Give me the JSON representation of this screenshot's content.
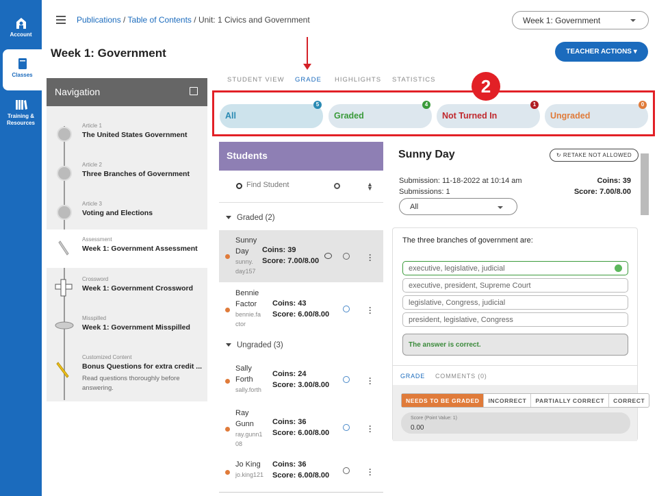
{
  "rail": {
    "items": [
      {
        "label": "Account",
        "icon": "account-icon"
      },
      {
        "label": "Classes",
        "icon": "book-icon"
      },
      {
        "label": "Training & Resources",
        "icon": "library-icon"
      }
    ]
  },
  "breadcrumb": {
    "link1": "Publications",
    "sep1": " / ",
    "link2": "Table of Contents",
    "sep2": " / ",
    "current": "Unit: 1 Civics and Government"
  },
  "week_select": {
    "value": "Week 1: Government"
  },
  "page_title": "Week 1: Government",
  "teacher_actions": "TEACHER ACTIONS ▾",
  "navigation": {
    "title": "Navigation",
    "items": [
      {
        "sub": "Article 1",
        "title": "The United States Government"
      },
      {
        "sub": "Article 2",
        "title": "Three Branches of Government"
      },
      {
        "sub": "Article 3",
        "title": "Voting and Elections"
      },
      {
        "sub": "Assessment",
        "title": "Week 1: Government Assessment"
      },
      {
        "sub": "Crossword",
        "title": "Week 1: Government Crossword"
      },
      {
        "sub": "Misspilled",
        "title": "Week 1: Government Misspilled"
      },
      {
        "sub": "Customized Content",
        "title": "Bonus Questions for extra credit ...",
        "desc": "Read questions thoroughly before answering."
      }
    ]
  },
  "tabs": [
    "STUDENT VIEW",
    "GRADE",
    "HIGHLIGHTS",
    "STATISTICS"
  ],
  "annotation_number": "2",
  "filters": [
    {
      "label": "All",
      "count": "5",
      "color": "#2a8ab3",
      "badge": "#2a8ab3"
    },
    {
      "label": "Graded",
      "count": "4",
      "color": "#3a9a3a",
      "badge": "#3a9a3a"
    },
    {
      "label": "Not Turned In",
      "count": "1",
      "color": "#c0282d",
      "badge": "#b01e23"
    },
    {
      "label": "Ungraded",
      "count": "0",
      "color": "#e07b3a",
      "badge": "#e07b3a"
    }
  ],
  "students": {
    "title": "Students",
    "search_placeholder": "Find Student",
    "groups": {
      "graded": "Graded (2)",
      "ungraded": "Ungraded (3)"
    },
    "rows": [
      {
        "first": "Sunny",
        "last": "Day",
        "user": "sunny.day157",
        "user_a": "sunny.",
        "user_b": "day157",
        "coins": "Coins: 39",
        "score": "Score: 7.00/8.00"
      },
      {
        "first": "Bennie",
        "last": "Factor",
        "user": "bennie.factor",
        "user_a": "bennie.fa",
        "user_b": "ctor",
        "coins": "Coins: 43",
        "score": "Score: 6.00/8.00"
      },
      {
        "first": "Sally",
        "last": "Forth",
        "user": "sally.forth",
        "user_a": "sally.forth",
        "user_b": "",
        "coins": "Coins: 24",
        "score": "Score: 3.00/8.00"
      },
      {
        "first": "Ray",
        "last": "Gunn",
        "user": "ray.gunn108",
        "user_a": "ray.gunn1",
        "user_b": "08",
        "coins": "Coins: 36",
        "score": "Score: 6.00/8.00"
      },
      {
        "first": "Jo King",
        "last": "",
        "user": "jo.king121",
        "user_a": "jo.king121",
        "user_b": "",
        "coins": "Coins: 36",
        "score": "Score: 6.00/8.00"
      }
    ]
  },
  "detail": {
    "name": "Sunny Day",
    "retake": "RETAKE NOT ALLOWED",
    "submission": "Submission: 11-18-2022 at 10:14 am",
    "submissions": "Submissions: 1",
    "coins": "Coins: 39",
    "score": "Score: 7.00/8.00",
    "select": "All",
    "question": "The three branches of government are:",
    "options": [
      "executive, legislative, judicial",
      "executive, president, Supreme Court",
      "legislative, Congress, judicial",
      "president, legislative, Congress"
    ],
    "feedback": "The answer is correct.",
    "grade_tabs": [
      "GRADE",
      "COMMENTS (0)"
    ],
    "grade_buttons": [
      "NEEDS TO BE GRADED",
      "INCORRECT",
      "PARTIALLY CORRECT",
      "CORRECT"
    ],
    "score_label": "Score (Point Value: 1)",
    "score_value": "0.00"
  }
}
